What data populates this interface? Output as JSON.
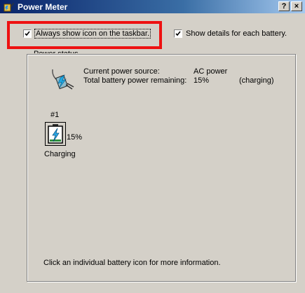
{
  "window": {
    "title": "Power Meter",
    "help_label": "?",
    "close_label": "×"
  },
  "options": {
    "show_icon": {
      "label": "Always show icon on the taskbar.",
      "checked": true
    },
    "show_details": {
      "label": "Show details for each battery.",
      "checked": true
    }
  },
  "power_status": {
    "group_label": "Power status",
    "source_label": "Current power source:",
    "source_value": "AC power",
    "remaining_label": "Total battery power remaining:",
    "remaining_value": "15%",
    "remaining_state": "(charging)"
  },
  "battery": {
    "number": "#1",
    "percent": "15%",
    "status": "Charging",
    "level": 0.15
  },
  "footer": "Click an individual battery icon for more information.",
  "colors": {
    "highlight": "#ee1111",
    "dialog_bg": "#d4d0c8",
    "titlebar_start": "#0a246a",
    "titlebar_end": "#a6caf0"
  },
  "icons": [
    "power-meter-app-icon",
    "power-plug-icon",
    "battery-charging-icon",
    "checkmark-icon"
  ]
}
